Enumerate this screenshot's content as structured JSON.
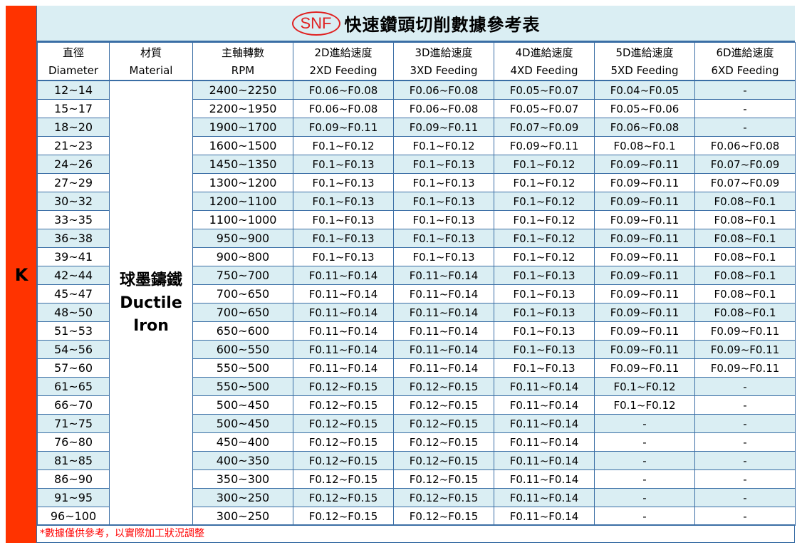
{
  "logo": "SNF",
  "title": "快速鑽頭切削數據參考表",
  "category_label": "K",
  "headers": [
    {
      "zh": "直徑",
      "en": "Diameter"
    },
    {
      "zh": "材質",
      "en": "Material"
    },
    {
      "zh": "主軸轉數",
      "en": "RPM"
    },
    {
      "zh": "2D進給速度",
      "en": "2XD Feeding"
    },
    {
      "zh": "3D進給速度",
      "en": "3XD Feeding"
    },
    {
      "zh": "4D進給速度",
      "en": "4XD Feeding"
    },
    {
      "zh": "5D進給速度",
      "en": "5XD Feeding"
    },
    {
      "zh": "6D進給速度",
      "en": "6XD Feeding"
    }
  ],
  "material": {
    "zh": "球墨鑄鐵",
    "en_line1": "Ductile",
    "en_line2": "Iron"
  },
  "rows": [
    [
      "12~14",
      "2400~2250",
      "F0.06~F0.08",
      "F0.06~F0.08",
      "F0.05~F0.07",
      "F0.04~F0.05",
      "-"
    ],
    [
      "15~17",
      "2200~1950",
      "F0.06~F0.08",
      "F0.06~F0.08",
      "F0.05~F0.07",
      "F0.05~F0.06",
      "-"
    ],
    [
      "18~20",
      "1900~1700",
      "F0.09~F0.11",
      "F0.09~F0.11",
      "F0.07~F0.09",
      "F0.06~F0.08",
      "-"
    ],
    [
      "21~23",
      "1600~1500",
      "F0.1~F0.12",
      "F0.1~F0.12",
      "F0.09~F0.11",
      "F0.08~F0.1",
      "F0.06~F0.08"
    ],
    [
      "24~26",
      "1450~1350",
      "F0.1~F0.13",
      "F0.1~F0.13",
      "F0.1~F0.12",
      "F0.09~F0.11",
      "F0.07~F0.09"
    ],
    [
      "27~29",
      "1300~1200",
      "F0.1~F0.13",
      "F0.1~F0.13",
      "F0.1~F0.12",
      "F0.09~F0.11",
      "F0.07~F0.09"
    ],
    [
      "30~32",
      "1200~1100",
      "F0.1~F0.13",
      "F0.1~F0.13",
      "F0.1~F0.12",
      "F0.09~F0.11",
      "F0.08~F0.1"
    ],
    [
      "33~35",
      "1100~1000",
      "F0.1~F0.13",
      "F0.1~F0.13",
      "F0.1~F0.12",
      "F0.09~F0.11",
      "F0.08~F0.1"
    ],
    [
      "36~38",
      "950~900",
      "F0.1~F0.13",
      "F0.1~F0.13",
      "F0.1~F0.12",
      "F0.09~F0.11",
      "F0.08~F0.1"
    ],
    [
      "39~41",
      "900~800",
      "F0.1~F0.13",
      "F0.1~F0.13",
      "F0.1~F0.12",
      "F0.09~F0.11",
      "F0.08~F0.1"
    ],
    [
      "42~44",
      "750~700",
      "F0.11~F0.14",
      "F0.11~F0.14",
      "F0.1~F0.13",
      "F0.09~F0.11",
      "F0.08~F0.1"
    ],
    [
      "45~47",
      "700~650",
      "F0.11~F0.14",
      "F0.11~F0.14",
      "F0.1~F0.13",
      "F0.09~F0.11",
      "F0.08~F0.1"
    ],
    [
      "48~50",
      "700~650",
      "F0.11~F0.14",
      "F0.11~F0.14",
      "F0.1~F0.13",
      "F0.09~F0.11",
      "F0.08~F0.1"
    ],
    [
      "51~53",
      "650~600",
      "F0.11~F0.14",
      "F0.11~F0.14",
      "F0.1~F0.13",
      "F0.09~F0.11",
      "F0.09~F0.11"
    ],
    [
      "54~56",
      "600~550",
      "F0.11~F0.14",
      "F0.11~F0.14",
      "F0.1~F0.13",
      "F0.09~F0.11",
      "F0.09~F0.11"
    ],
    [
      "57~60",
      "550~500",
      "F0.11~F0.14",
      "F0.11~F0.14",
      "F0.1~F0.13",
      "F0.09~F0.11",
      "F0.09~F0.11"
    ],
    [
      "61~65",
      "550~500",
      "F0.12~F0.15",
      "F0.12~F0.15",
      "F0.11~F0.14",
      "F0.1~F0.12",
      "-"
    ],
    [
      "66~70",
      "500~450",
      "F0.12~F0.15",
      "F0.12~F0.15",
      "F0.11~F0.14",
      "F0.1~F0.12",
      "-"
    ],
    [
      "71~75",
      "500~450",
      "F0.12~F0.15",
      "F0.12~F0.15",
      "F0.11~F0.14",
      "-",
      "-"
    ],
    [
      "76~80",
      "450~400",
      "F0.12~F0.15",
      "F0.12~F0.15",
      "F0.11~F0.14",
      "-",
      "-"
    ],
    [
      "81~85",
      "400~350",
      "F0.12~F0.15",
      "F0.12~F0.15",
      "F0.11~F0.14",
      "-",
      "-"
    ],
    [
      "86~90",
      "350~300",
      "F0.12~F0.15",
      "F0.12~F0.15",
      "F0.11~F0.14",
      "-",
      "-"
    ],
    [
      "91~95",
      "300~250",
      "F0.12~F0.15",
      "F0.12~F0.15",
      "F0.11~F0.14",
      "-",
      "-"
    ],
    [
      "96~100",
      "300~250",
      "F0.12~F0.15",
      "F0.12~F0.15",
      "F0.11~F0.14",
      "-",
      "-"
    ]
  ],
  "note": "*數據僅供參考，以實際加工狀況調整",
  "colors": {
    "category_bar": "#ff3300",
    "stripe": "#daeef3",
    "border": "#3a6ea5",
    "note": "#ff0000"
  }
}
